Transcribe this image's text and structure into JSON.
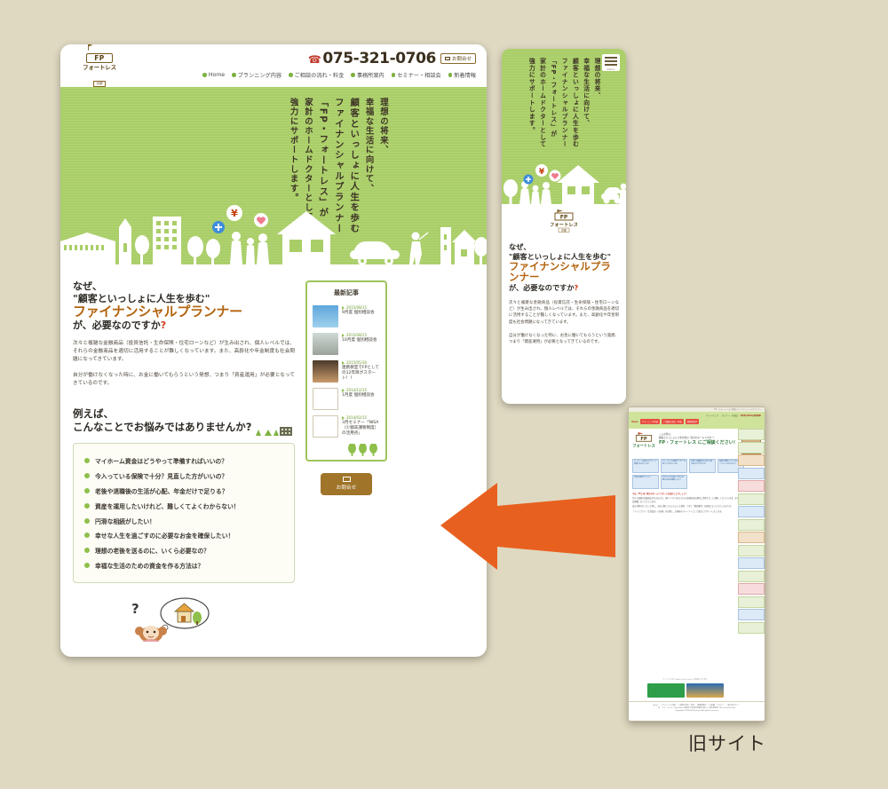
{
  "brand": {
    "logo_fp": "FP",
    "logo_name": "フォートレス",
    "logo_sub": "京都",
    "flag_icon": "flag-icon"
  },
  "desktop": {
    "header": {
      "tel": "075-321-0706",
      "tel_icon": "phone-icon",
      "contact_pill": "お問合せ",
      "contact_pill_icon": "mail-icon",
      "nav": [
        "Home",
        "プランニング内容",
        "ご相談の流れ・料金",
        "事務所案内",
        "セミナー・相談会",
        "新着情報"
      ]
    },
    "hero": {
      "vertical_lines": [
        "理想の将来、",
        "幸福な生活に向けて、",
        "顧客といっしょに人生を歩む",
        "ファイナンシャルプランナー",
        "「FP・フォートレス」が",
        "家計のホームドクターとして",
        "強力にサポートします。"
      ],
      "illustration": "town-silhouette-illustration",
      "bubble_yen": "¥",
      "bubble_heart": "heart-icon",
      "bubble_plus": "plus-icon"
    },
    "main": {
      "heading_line1": "なぜ、",
      "heading_line2": "\"顧客といっしょに人生を歩む\"",
      "heading_line3": "ファイナンシャルプランナー",
      "heading_line4": "が、必要なのですか",
      "heading_q": "?",
      "para1": "次々と複雑な金融商品（投資信託・生命保険・住宅ローンなど）が生み出され、個人レベルでは、それらの金融商品を適切に活用することが難しくなっています。また、高齢化や年金制度も社会問題になってきています。",
      "para2": "自分が働けなくなった時に、お金に働いてもらうという発想、つまり「資産運用」が必要となってきているのです。",
      "example_line1": "例えば、",
      "example_line2": "こんなことでお悩みではありませんか?",
      "worries": [
        "マイホーム資金はどうやって準備すればいいの？",
        "今入っている保険で十分？見直した方がいいの？",
        "老後や退職後の生活が心配、年金だけで足りる？",
        "資産を運用したいけれど、難しくてよくわからない！",
        "円滑な相続がしたい！",
        "幸せな人生を過ごすのに必要なお金を確保したい！",
        "理想の老後を送るのに、いくら必要なの？",
        "幸福な生活のための資金を作る方法は？"
      ],
      "girl_illustration": "girl-thinking-house-icon"
    },
    "sidebar": {
      "title": "最新記事",
      "articles": [
        {
          "date": "2015/08/15",
          "title": "9月度 個別相談会",
          "thumb": "photo-hand-coin"
        },
        {
          "date": "2015/08/15",
          "title": "10月度 個別相談会",
          "thumb": "photo-field"
        },
        {
          "date": "2015/05/30",
          "title": "連携教室でFPとしての12年目がスタート！！",
          "thumb": "photo-hands"
        },
        {
          "date": "2014/12/15",
          "title": "1月度 個別相談会",
          "thumb": "logo-placeholder"
        },
        {
          "date": "2014/02/15",
          "title": "3月セミナー「NISA（少額非課税制度）の活用点」",
          "thumb": "logo-placeholder"
        }
      ],
      "contact_button": "お問合せ",
      "contact_button_icon": "mail-icon"
    }
  },
  "mobile": {
    "menu_label": "menu",
    "menu_icon": "hamburger-icon",
    "vertical_lines": [
      "理想の将来、",
      "幸福な生活に向けて、",
      "顧客といっしょに人生を歩む",
      "ファイナンシャルプランナー",
      "「FP・フォートレス」が",
      "家計のホームドクターとして",
      "強力にサポートします。"
    ],
    "heading_line1": "なぜ、",
    "heading_line2": "\"顧客といっしょに人生を歩む\"",
    "heading_line3": "ファイナンシャルプランナー",
    "heading_line4": "が、必要なのですか",
    "heading_q": "?",
    "para1": "次々と複雑な金融商品（投資信託・生命保険・住宅ローンなど）が生み出され、個人レベルでは、それらの金融商品を適切に活用することが難しくなっています。また、高齢化や年金制度も社会問題になってきています。",
    "para2": "自分が働けなくなった時に、お金に働いてもらうという発想、つまり「資産運用」が必要となってきているのです。"
  },
  "oldsite": {
    "caption": "旧サイト",
    "topbar": "FP・フォートレス 京都のファイナンシャルプランナー",
    "tel": "075-321-0706",
    "nav_small": [
      "サイトマップ",
      "セミナー・相談会",
      "セミナー・お申込み"
    ],
    "nav_buttons": [
      "プランニング内容",
      "ご相談の流れ・料金",
      "事務所案内"
    ],
    "home": "Home",
    "claim1": "こんな時は、",
    "claim2": "顧客といっしょに人生を歩む \"家計のホームドクター\"",
    "claim3": "FP・フォートレス にご相談ください！",
    "tiles": [
      "マイホーム資金はどうやって準備すればいいの？",
      "今入っている保険で十分？見直した方がいいの？",
      "老後や退職後の生活が心配、年金だけで足りる？",
      "資産を運用したいけれど難しくてよくわからない！",
      "円滑な相続がしたい！",
      "幸せな人生を過ごすのに必要なお金を確保したい！"
    ],
    "section_q": "では、FPとは？家計のホームドクターとは誰のことでしょう？",
    "body1": "次々と複雑な金融商品が生み出され、個人レベルではそれらの金融商品を適切に活用することが難しくなっています。また、高齢化や年金制度も社会問題になってきています。",
    "body2": "自分が働けなくなった時に、お金に働いてもらうという発想、つまり「資産運用」が必要となってきているのです。",
    "body3": "「ライフプラン（生涯設計）の実現」を目標に、お客様のパートナーとして強力にサポートいたします。",
    "sign": "ーグラン二ングの特徴ー",
    "flash_note": "クリックすると Adobe Flash Player が必要になります",
    "footer_nav": "Home ｜ プランニング内容 ｜ ご相談の流れ・料金 ｜ 事務所案内 ｜ FP試験 ｜ セミナー ｜ 個人型セミナー",
    "footer_addr": "FP・フォートレス 〒600-8001 京都市下京区四条通烏丸西入ル 南不動堂町 TEL.075-321-0706",
    "footer_copy": "Copyright(C)2006 FP-Fortress All rights reserved."
  },
  "arrow": {
    "name": "arrow-pointing-left",
    "color": "#e8601f"
  },
  "colors": {
    "green": "#a9ce67",
    "orange_heading": "#b3640f",
    "red_q": "#d03a1c",
    "brown_button": "#a0752a",
    "bg": "#dfd9c1"
  }
}
